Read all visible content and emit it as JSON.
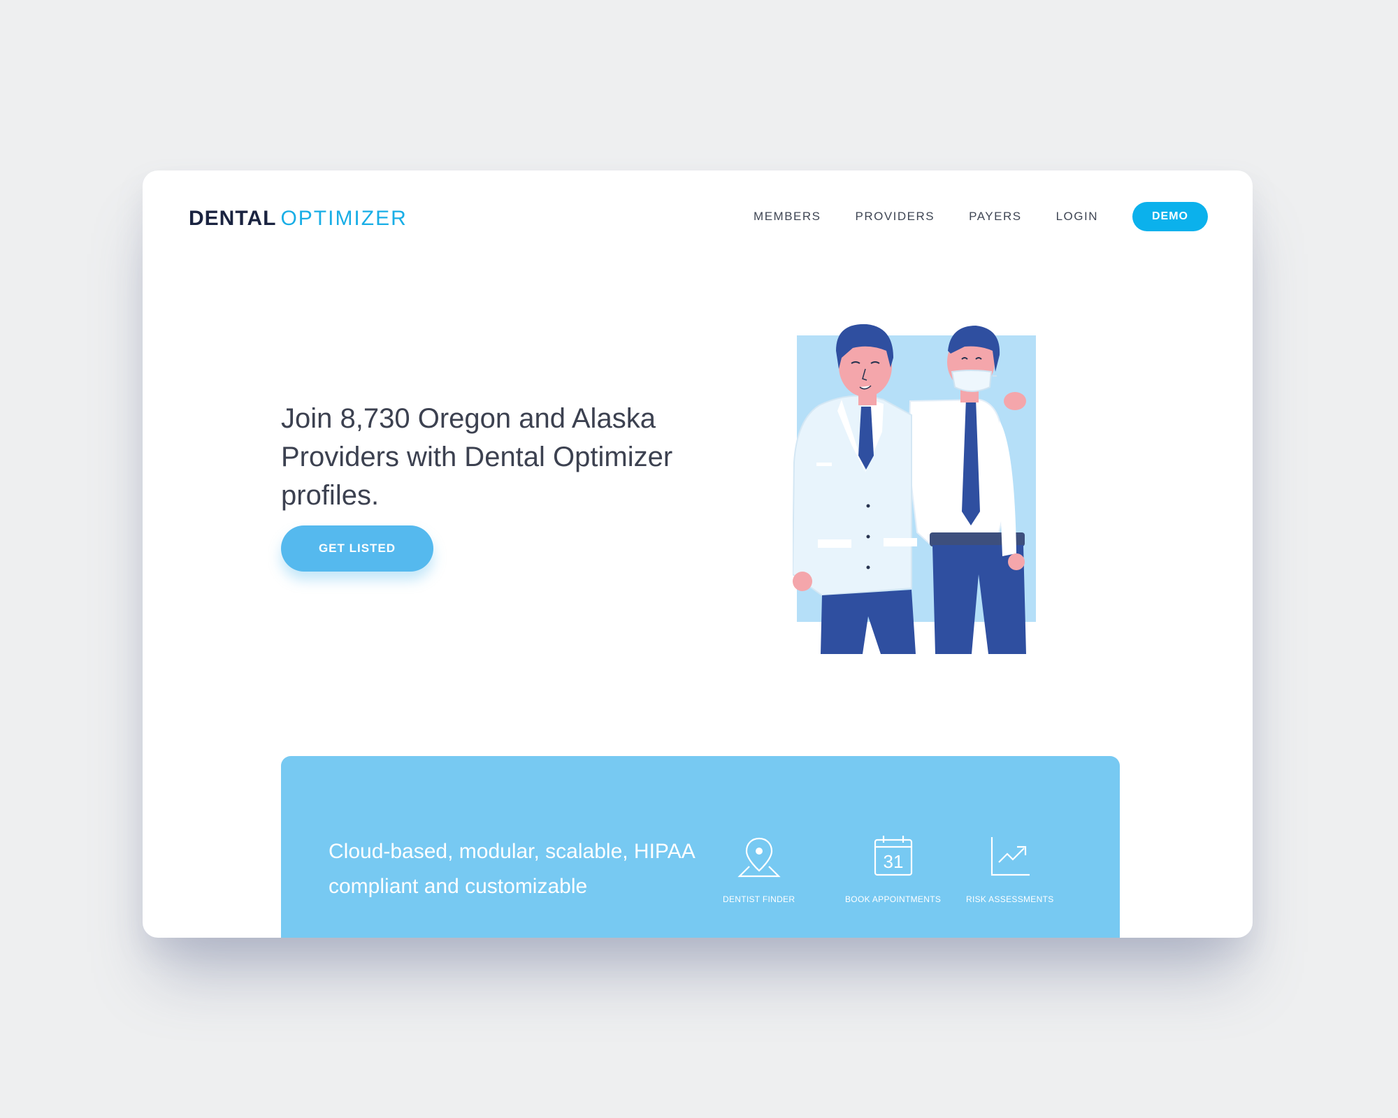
{
  "brand": {
    "part1": "DENTAL",
    "part2": "OPTIMIZER"
  },
  "nav": {
    "items": [
      "MEMBERS",
      "PROVIDERS",
      "PAYERS",
      "LOGIN"
    ],
    "demo_label": "DEMO"
  },
  "hero": {
    "headline": "Join 8,730 Oregon and Alaska Providers with Dental Optimizer profiles.",
    "cta_label": "GET LISTED"
  },
  "feature": {
    "title": "Cloud-based, modular, scalable, HIPAA compliant and customizable",
    "description": "",
    "items": [
      {
        "label": "DENTIST FINDER",
        "icon": "location-pin-icon"
      },
      {
        "label": "BOOK APPOINTMENTS",
        "icon": "calendar-icon",
        "calendar_day": "31"
      },
      {
        "label": "RISK ASSESSMENTS",
        "icon": "trend-chart-icon"
      }
    ]
  },
  "colors": {
    "accent": "#0bb1ec",
    "cta": "#55b9ee",
    "feature_bg": "#77c9f2",
    "brand_dark": "#1a2340",
    "illustration_bg": "#b5dff8",
    "navy": "#2f4fa0",
    "skin": "#f4a6ab"
  }
}
